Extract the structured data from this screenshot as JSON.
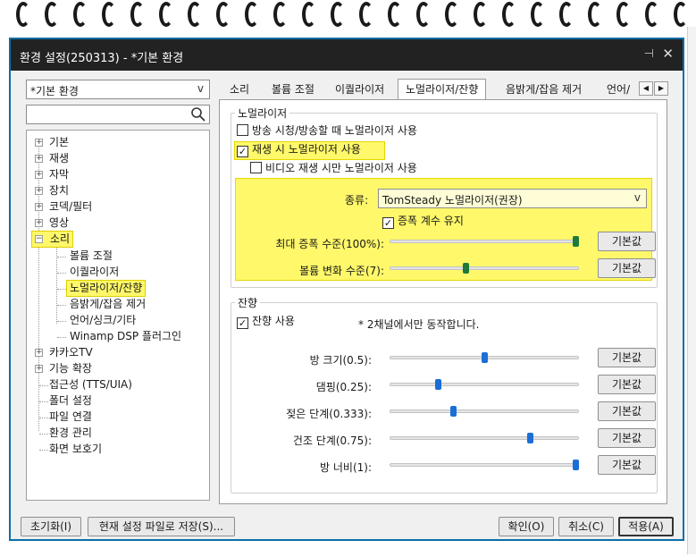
{
  "window": {
    "title": "환경 설정(250313) - *기본 환경",
    "pin_glyph": "⊣",
    "close_glyph": "✕"
  },
  "profile_combo": {
    "value": "*기본 환경",
    "arrow": "v"
  },
  "search": {
    "value": ""
  },
  "tree": {
    "items": [
      {
        "label": "기본",
        "expander": "+"
      },
      {
        "label": "재생",
        "expander": "+"
      },
      {
        "label": "자막",
        "expander": "+"
      },
      {
        "label": "장치",
        "expander": "+"
      },
      {
        "label": "코덱/필터",
        "expander": "+"
      },
      {
        "label": "영상",
        "expander": "+"
      },
      {
        "label": "소리",
        "expander": "−"
      },
      {
        "label": "볼륨 조절"
      },
      {
        "label": "이퀄라이저"
      },
      {
        "label": "노멀라이저/잔향"
      },
      {
        "label": "음밝게/잡음 제거"
      },
      {
        "label": "언어/싱크/기타"
      },
      {
        "label": "Winamp DSP 플러그인"
      },
      {
        "label": "카카오TV",
        "expander": "+"
      },
      {
        "label": "기능 확장",
        "expander": "+"
      },
      {
        "label": "접근성 (TTS/UIA)"
      },
      {
        "label": "폴더 설정"
      },
      {
        "label": "파일 연결"
      },
      {
        "label": "환경 관리"
      },
      {
        "label": "화면 보호기"
      }
    ]
  },
  "tabs": [
    "소리",
    "볼륨 조절",
    "이퀄라이저",
    "노멀라이저/잔향",
    "음밝게/잡음 제거",
    "언어/싱"
  ],
  "normalizer": {
    "group_title": "노멀라이저",
    "broadcast_check": {
      "label": "방송 시청/방송할 때 노멀라이저 사용",
      "checked": false
    },
    "playback_check": {
      "label": "재생 시 노멀라이저 사용",
      "checked": true
    },
    "video_only_check": {
      "label": "비디오 재생 시만 노멀라이저 사용",
      "checked": false
    },
    "type_label": "종류:",
    "type_value": "TomSteady 노멀라이저(권장)",
    "type_arrow": "v",
    "keep_gain_check": {
      "label": "증폭 계수 유지",
      "checked": true
    },
    "sliders": [
      {
        "label": "최대 증폭 수준(100%):",
        "value": 1.0,
        "reset": "기본값"
      },
      {
        "label": "볼륨 변화 수준(7):",
        "value": 0.4,
        "reset": "기본값"
      }
    ]
  },
  "reverb": {
    "group_title": "잔향",
    "use_check": {
      "label": "잔향 사용",
      "checked": true
    },
    "note": "* 2채널에서만 동작합니다.",
    "sliders": [
      {
        "label": "방 크기(0.5):",
        "value": 0.5,
        "reset": "기본값"
      },
      {
        "label": "댐핑(0.25):",
        "value": 0.25,
        "reset": "기본값"
      },
      {
        "label": "젖은 단계(0.333):",
        "value": 0.333,
        "reset": "기본값"
      },
      {
        "label": "건조 단계(0.75):",
        "value": 0.75,
        "reset": "기본값"
      },
      {
        "label": "방 너비(1):",
        "value": 1.0,
        "reset": "기본값"
      }
    ]
  },
  "footer": {
    "reset_label": "초기화(I)",
    "save_label": "현재 설정 파일로 저장(S)...",
    "ok_label": "확인(O)",
    "cancel_label": "취소(C)",
    "apply_label": "적용(A)"
  },
  "colors": {
    "highlight": "#fff86a",
    "normalizer_thumb": "#1f7a3a",
    "reverb_thumb": "#1a6fd6",
    "titlebar": "#222222",
    "border_accent": "#0b6ea8"
  }
}
